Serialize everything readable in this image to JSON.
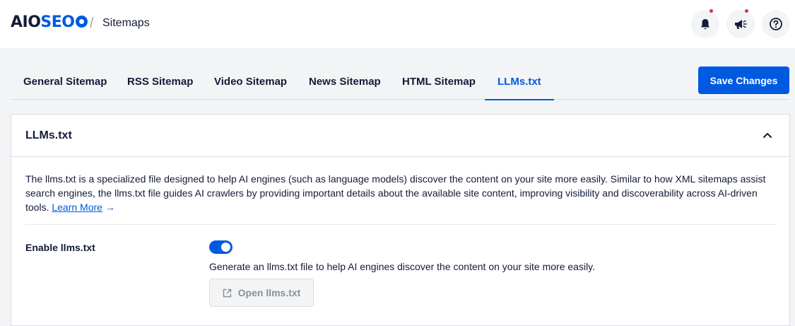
{
  "header": {
    "logo_prefix": "AIO",
    "logo_suffix": "SEO",
    "breadcrumb_separator": "/",
    "breadcrumb": "Sitemaps",
    "notification_dot_color": "#df2a4a"
  },
  "tabs": [
    {
      "label": "General Sitemap",
      "active": false
    },
    {
      "label": "RSS Sitemap",
      "active": false
    },
    {
      "label": "Video Sitemap",
      "active": false
    },
    {
      "label": "News Sitemap",
      "active": false
    },
    {
      "label": "HTML Sitemap",
      "active": false
    },
    {
      "label": "LLMs.txt",
      "active": true
    }
  ],
  "save_button": "Save Changes",
  "card": {
    "title": "LLMs.txt",
    "description": "The llms.txt is a specialized file designed to help AI engines (such as language models) discover the content on your site more easily. Similar to how XML sitemaps assist search engines, the llms.txt file guides AI crawlers by providing important details about the available site content, improving visibility and discoverability across AI-driven tools.",
    "learn_more": "Learn More",
    "learn_more_arrow": "→",
    "setting_label": "Enable llms.txt",
    "toggle_enabled": true,
    "setting_description": "Generate an llms.txt file to help AI engines discover the content on your site more easily.",
    "open_button": "Open llms.txt"
  },
  "colors": {
    "accent": "#005ae0",
    "text": "#141b38",
    "background": "#f3f4f5"
  },
  "icons": [
    "bell-icon",
    "megaphone-icon",
    "help-icon",
    "chevron-up-icon",
    "external-link-icon"
  ]
}
